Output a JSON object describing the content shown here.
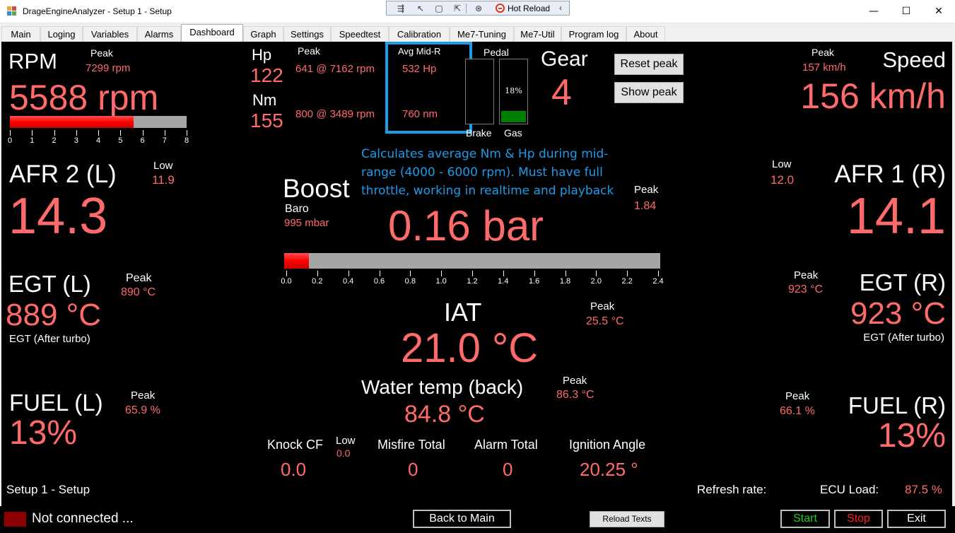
{
  "window": {
    "title": "DrageEngineAnalyzer - Setup 1 - Setup",
    "minimize": "—",
    "maximize": "☐",
    "close": "✕"
  },
  "hotreload": {
    "icon1": "⇶",
    "icon2": "↖",
    "icon3": "▢",
    "icon4": "⇱",
    "icon5": "⊛",
    "label": "Hot Reload",
    "collapse": "‹"
  },
  "tabs": [
    "Main",
    "Loging",
    "Variables",
    "Alarms",
    "Dashboard",
    "Graph",
    "Settings",
    "Speedtest",
    "Calibration",
    "Me7-Tuning",
    "Me7-Util",
    "Program log",
    "About"
  ],
  "active_tab": "Dashboard",
  "rpm": {
    "label": "RPM",
    "peak_label": "Peak",
    "peak": "7299 rpm",
    "value": "5588 rpm",
    "fill": 0.6985,
    "scale": [
      "0",
      "1",
      "2",
      "3",
      "4",
      "5",
      "6",
      "7",
      "8"
    ]
  },
  "hp": {
    "label": "Hp",
    "value": "122",
    "peak_label": "Peak",
    "peak": "641 @ 7162 rpm"
  },
  "nm": {
    "label": "Nm",
    "value": "155",
    "peak": "800 @ 3489 rpm"
  },
  "avg_mid": {
    "label": "Avg Mid-R",
    "hp": "532 Hp",
    "nm": "760 nm"
  },
  "pedal": {
    "label": "Pedal",
    "brake_label": "Brake",
    "gas_label": "Gas",
    "gas_percent": "18%",
    "gas_fill": 0.18,
    "brake_fill": 0
  },
  "gear": {
    "label": "Gear",
    "value": "4"
  },
  "buttons": {
    "reset_peak": "Reset peak",
    "show_peak": "Show peak"
  },
  "speed": {
    "label": "Speed",
    "peak_label": "Peak",
    "peak": "157 km/h",
    "value": "156 km/h"
  },
  "annotation": "Calculates average Nm & Hp during mid-range (4000 - 6000 rpm). Must have full throttle, working in realtime and playback",
  "annotation_lines": [
    "Calculates average Nm & Hp during mid-",
    "range (4000 - 6000 rpm). Must have full",
    "throttle, working in realtime and playback"
  ],
  "afr_left": {
    "label": "AFR  2 (L)",
    "low_label": "Low",
    "low": "11.9",
    "value": "14.3"
  },
  "afr_right": {
    "label": "AFR  1 (R)",
    "low_label": "Low",
    "low": "12.0",
    "value": "14.1"
  },
  "boost": {
    "label": "Boost",
    "baro_label": "Baro",
    "baro": "995 mbar",
    "peak_label": "Peak",
    "peak": "1.84",
    "value": "0.16 bar",
    "fill": 0.0667,
    "scale": [
      "0.0",
      "0.2",
      "0.4",
      "0.6",
      "0.8",
      "1.0",
      "1.2",
      "1.4",
      "1.6",
      "1.8",
      "2.0",
      "2.2",
      "2.4"
    ]
  },
  "egt_left": {
    "label": "EGT (L)",
    "peak_label": "Peak",
    "peak": "890 °C",
    "value": "889 °C",
    "sub": "EGT (After turbo)"
  },
  "egt_right": {
    "label": "EGT (R)",
    "peak_label": "Peak",
    "peak": "923 °C",
    "value": "923 °C",
    "sub": "EGT (After turbo)"
  },
  "iat": {
    "label": "IAT",
    "peak_label": "Peak",
    "peak": "25.5 °C",
    "value": "21.0 °C"
  },
  "water": {
    "label": "Water temp (back)",
    "peak_label": "Peak",
    "peak": "86.3 °C",
    "value": "84.8 °C"
  },
  "fuel_left": {
    "label": "FUEL (L)",
    "peak_label": "Peak",
    "peak": "65.9 %",
    "value": "13%"
  },
  "fuel_right": {
    "label": "FUEL (R)",
    "peak_label": "Peak",
    "peak": "66.1 %",
    "value": "13%"
  },
  "knock": {
    "label": "Knock CF",
    "low_label": "Low",
    "low": "0.0",
    "value": "0.0"
  },
  "misfire": {
    "label": "Misfire Total",
    "value": "0"
  },
  "alarm": {
    "label": "Alarm Total",
    "value": "0"
  },
  "ignition": {
    "label": "Ignition Angle",
    "value": "20.25 °"
  },
  "footer": {
    "setup": "Setup 1 - Setup",
    "refresh_label": "Refresh rate:",
    "ecu_label": "ECU Load:",
    "ecu_value": "87.5 %"
  },
  "bottom": {
    "status": "Not connected ...",
    "back": "Back to Main",
    "reload": "Reload Texts",
    "start": "Start",
    "stop": "Stop",
    "exit": "Exit"
  },
  "colors": {
    "value_red": "#ff6b6b",
    "start_green": "#22cc22",
    "stop_red": "#ff2020",
    "annotation_blue": "#1e9be8",
    "gas_green": "#008000"
  }
}
